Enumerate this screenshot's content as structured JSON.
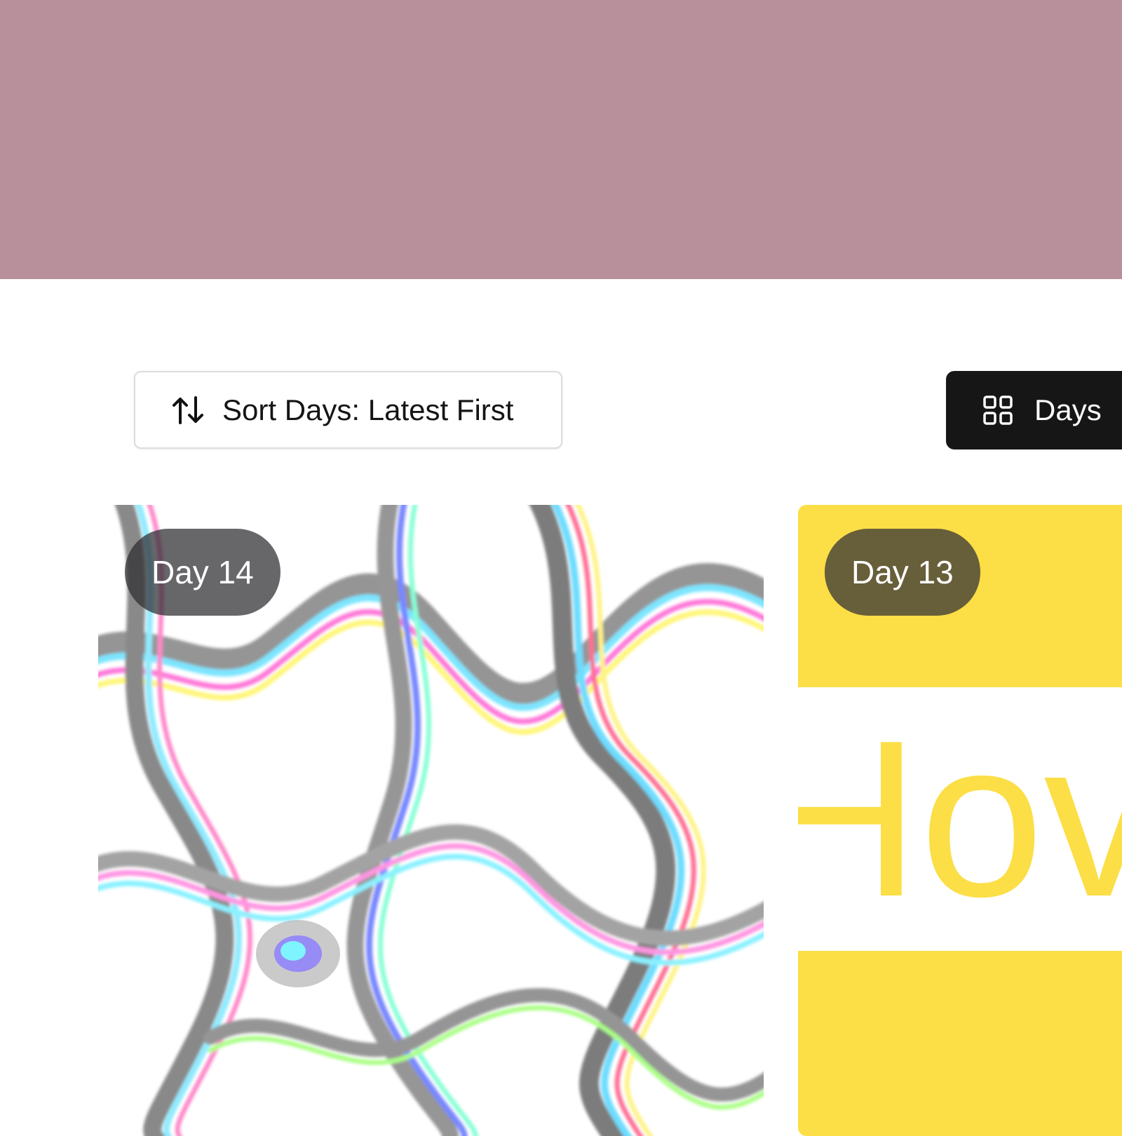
{
  "colors": {
    "hero": "#b7909c",
    "toggle_bg": "#161616",
    "card13_bg": "#fcde46"
  },
  "toolbar": {
    "sort_icon": "sort-arrows-icon",
    "sort_label": "Sort Days: Latest First",
    "view_icon": "grid-icon",
    "view_label": "Days"
  },
  "cards": [
    {
      "badge": "Day 14",
      "image": "liquid-marble-art"
    },
    {
      "badge": "Day 13",
      "image_text": "Hove"
    }
  ]
}
